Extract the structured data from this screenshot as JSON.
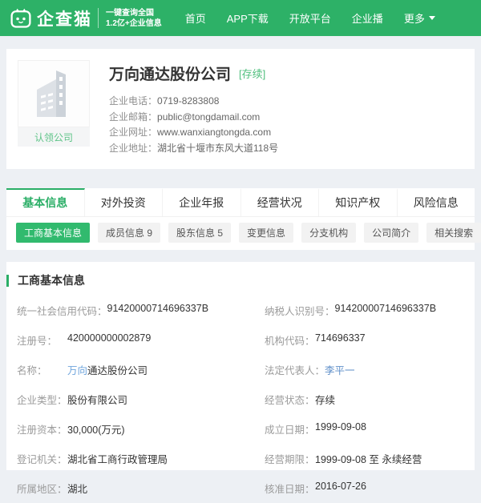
{
  "theme": {
    "primary_green": "#2db167",
    "active_green": "#2aae66",
    "pill_green": "#31ba6e",
    "link_blue": "#5f8fc9",
    "highlight_blue": "#6ea4dc"
  },
  "header": {
    "logo_name": "企查猫",
    "tagline_line1": "一键查询全国",
    "tagline_line2": "1.2亿+企业信息",
    "nav": [
      {
        "label": "首页"
      },
      {
        "label": "APP下载"
      },
      {
        "label": "开放平台"
      },
      {
        "label": "企业播"
      },
      {
        "label": "更多"
      }
    ]
  },
  "company": {
    "name": "万向通达股份公司",
    "status_tag": "[存续]",
    "claim_label": "认领公司",
    "info": [
      {
        "label": "企业电话：",
        "value": "0719-8283808"
      },
      {
        "label": "企业邮箱：",
        "value": "public@tongdamail.com"
      },
      {
        "label": "企业网址：",
        "value": "www.wanxiangtongda.com"
      },
      {
        "label": "企业地址：",
        "value": "湖北省十堰市东风大道118号"
      }
    ]
  },
  "tabs": [
    {
      "label": "基本信息",
      "active": true
    },
    {
      "label": "对外投资",
      "active": false
    },
    {
      "label": "企业年报",
      "active": false
    },
    {
      "label": "经营状况",
      "active": false
    },
    {
      "label": "知识产权",
      "active": false
    },
    {
      "label": "风险信息",
      "active": false
    }
  ],
  "subtabs": [
    {
      "label": "工商基本信息",
      "active": true
    },
    {
      "label": "成员信息 9",
      "active": false
    },
    {
      "label": "股东信息 5",
      "active": false
    },
    {
      "label": "变更信息",
      "active": false
    },
    {
      "label": "分支机构",
      "active": false
    },
    {
      "label": "公司简介",
      "active": false
    },
    {
      "label": "相关搜索",
      "active": false
    }
  ],
  "section": {
    "title": "工商基本信息"
  },
  "table": {
    "rows": [
      {
        "left_label": "统一社会信用代码：",
        "left_value": "91420000714696337B",
        "right_label": "纳税人识别号：",
        "right_value": "91420000714696337B"
      },
      {
        "left_label": "注册号：",
        "left_value": "420000000002879",
        "right_label": "机构代码：",
        "right_value": "714696337"
      },
      {
        "left_label": "名称：",
        "left_value_highlight": "万向",
        "left_value_rest": "通达股份公司",
        "right_label": "法定代表人：",
        "right_value": "李平一"
      },
      {
        "left_label": "企业类型：",
        "left_value": "股份有限公司",
        "right_label": "经营状态：",
        "right_value": "存续"
      },
      {
        "left_label": "注册资本：",
        "left_value": "30,000(万元)",
        "right_label": "成立日期：",
        "right_value": "1999-09-08"
      },
      {
        "left_label": "登记机关：",
        "left_value": "湖北省工商行政管理局",
        "right_label": "经营期限：",
        "right_value": "1999-09-08 至 永续经营"
      },
      {
        "left_label": "所属地区：",
        "left_value": "湖北",
        "right_label": "核准日期：",
        "right_value": "2016-07-26"
      }
    ]
  }
}
